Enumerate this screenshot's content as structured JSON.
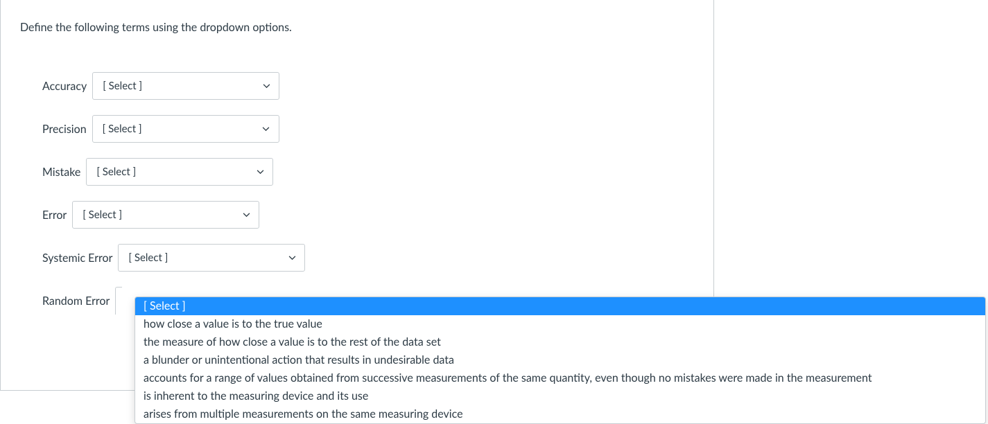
{
  "question": {
    "prompt": "Define the following terms using the dropdown options.",
    "select_placeholder": "[ Select ]",
    "terms": [
      {
        "label": "Accuracy"
      },
      {
        "label": "Precision"
      },
      {
        "label": "Mistake"
      },
      {
        "label": "Error"
      },
      {
        "label": "Systemic Error"
      },
      {
        "label": "Random Error"
      }
    ],
    "options": [
      "[ Select ]",
      "how close a value is to the true value",
      "the measure of how close a value is to the rest of the data set",
      "a blunder or unintentional action that results in undesirable data",
      "accounts for a range of values obtained from successive measurements of the same quantity, even though no mistakes were made in the measurement",
      "is inherent to the measuring device and its use",
      "arises from multiple measurements on the same measuring device"
    ]
  }
}
